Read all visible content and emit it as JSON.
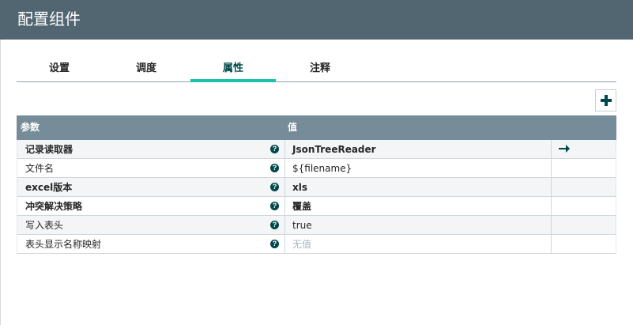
{
  "header": {
    "title": "配置组件"
  },
  "tabs": [
    {
      "label": "设置",
      "active": false
    },
    {
      "label": "调度",
      "active": false
    },
    {
      "label": "属性",
      "active": true
    },
    {
      "label": "注释",
      "active": false
    }
  ],
  "toolbar": {
    "add_icon": "plus-icon"
  },
  "table": {
    "headers": {
      "name": "参数",
      "value": "值"
    },
    "rows": [
      {
        "name": "记录读取器",
        "value": "JsonTreeReader",
        "bold": true,
        "help": "?",
        "action": "go-to-arrow-icon"
      },
      {
        "name": "文件名",
        "value": "${filename}",
        "bold": false,
        "help": "?"
      },
      {
        "name": "excel版本",
        "value": "xls",
        "bold": true,
        "help": "?"
      },
      {
        "name": "冲突解决策略",
        "value": "覆盖",
        "bold": true,
        "help": "?"
      },
      {
        "name": "写入表头",
        "value": "true",
        "bold": false,
        "help": "?"
      },
      {
        "name": "表头显示名称映射",
        "value": "无值",
        "bold": false,
        "placeholder": true,
        "help": "?"
      }
    ]
  },
  "colors": {
    "header_bg": "#526672",
    "table_header_bg": "#778c99",
    "accent": "#1bc1aa",
    "icon_dark": "#004849"
  }
}
